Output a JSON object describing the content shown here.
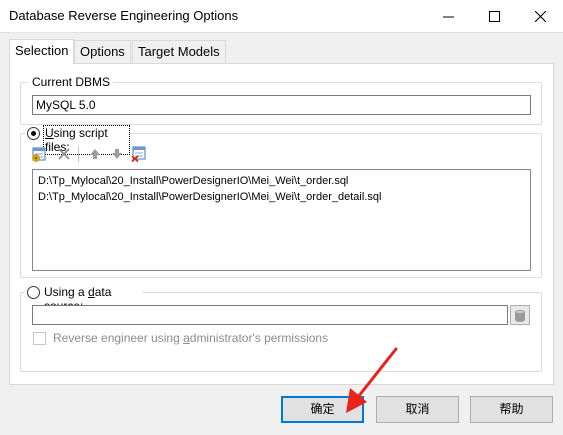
{
  "window": {
    "title": "Database Reverse Engineering Options",
    "controls": [
      "minimize-icon",
      "maximize-icon",
      "close-icon"
    ]
  },
  "tabs": [
    {
      "label": "Selection",
      "active": true
    },
    {
      "label": "Options",
      "active": false
    },
    {
      "label": "Target Models",
      "active": false
    }
  ],
  "current_dbms": {
    "legend": "Current DBMS",
    "value": "MySQL 5.0"
  },
  "script_files": {
    "radio_label": "Using script files:",
    "selected": true,
    "toolbar": [
      "add-files-icon",
      "delete-icon",
      "move-up-icon",
      "move-down-icon",
      "clear-all-icon"
    ],
    "files": [
      "D:\\Tp_Mylocal\\20_Install\\PowerDesignerIO\\Mei_Wei\\t_order.sql",
      "D:\\Tp_Mylocal\\20_Install\\PowerDesignerIO\\Mei_Wei\\t_order_detail.sql"
    ]
  },
  "data_source": {
    "radio_label": "Using a data source:",
    "selected": false,
    "value": "",
    "checkbox_label": "Reverse engineer using administrator's permissions",
    "checkbox_checked": false
  },
  "buttons": {
    "ok": "确定",
    "cancel": "取消",
    "help": "帮助"
  },
  "colors": {
    "annotation_arrow": "#e8231a",
    "default_button_border": "#0078d7"
  }
}
